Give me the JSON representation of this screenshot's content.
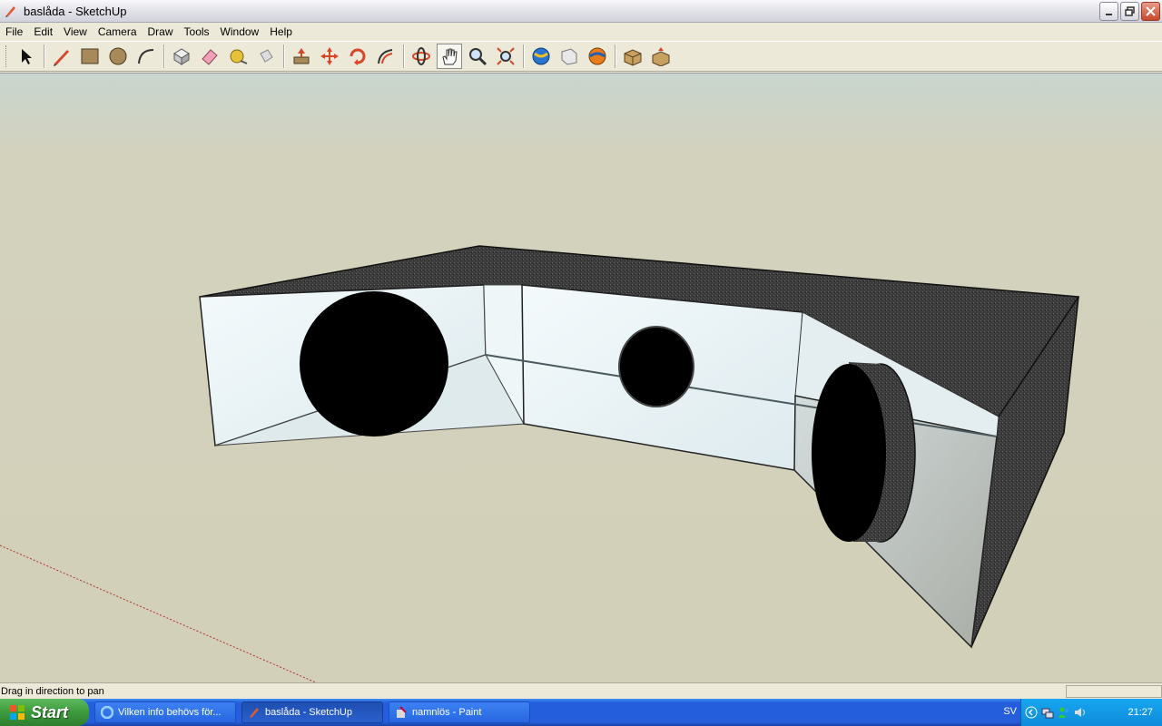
{
  "window": {
    "title": "baslåda - SketchUp",
    "controls": [
      "minimize",
      "restore",
      "close"
    ]
  },
  "menu": {
    "items": [
      "File",
      "Edit",
      "View",
      "Camera",
      "Draw",
      "Tools",
      "Window",
      "Help"
    ]
  },
  "toolbar": {
    "tools": [
      {
        "name": "select-tool",
        "icon": "arrow-icon"
      },
      {
        "name": "pencil-tool",
        "icon": "pencil-icon"
      },
      {
        "name": "rectangle-tool",
        "icon": "rectangle-icon"
      },
      {
        "name": "circle-tool",
        "icon": "circle-icon"
      },
      {
        "name": "arc-tool",
        "icon": "arc-icon"
      },
      {
        "name": "make-component-tool",
        "icon": "component-icon"
      },
      {
        "name": "eraser-tool",
        "icon": "eraser-icon"
      },
      {
        "name": "tape-measure-tool",
        "icon": "tape-measure-icon"
      },
      {
        "name": "paint-bucket-tool",
        "icon": "paint-bucket-icon"
      },
      {
        "name": "push-pull-tool",
        "icon": "push-pull-icon"
      },
      {
        "name": "move-tool",
        "icon": "move-icon"
      },
      {
        "name": "rotate-tool",
        "icon": "rotate-icon"
      },
      {
        "name": "offset-tool",
        "icon": "offset-icon"
      },
      {
        "name": "orbit-tool",
        "icon": "orbit-icon"
      },
      {
        "name": "pan-tool",
        "icon": "hand-icon",
        "active": true
      },
      {
        "name": "zoom-tool",
        "icon": "magnifier-icon"
      },
      {
        "name": "zoom-extents-tool",
        "icon": "zoom-extents-icon"
      },
      {
        "name": "get-models-tool",
        "icon": "globe-icon"
      },
      {
        "name": "share-model-tool",
        "icon": "share-icon"
      },
      {
        "name": "google-earth-tool",
        "icon": "earth-icon"
      },
      {
        "name": "get-components-tool",
        "icon": "components-box-icon"
      },
      {
        "name": "share-component-tool",
        "icon": "share-components-icon"
      }
    ]
  },
  "status": {
    "text": "Drag in direction to pan",
    "measurements_value": ""
  },
  "taskbar": {
    "start_label": "Start",
    "tasks": [
      {
        "label": "Vilken info behövs för...",
        "icon": "ie-icon",
        "active": false
      },
      {
        "label": "baslåda - SketchUp",
        "icon": "sketchup-icon",
        "active": true
      },
      {
        "label": "namnlös - Paint",
        "icon": "paint-icon",
        "active": false
      }
    ],
    "language": "SV",
    "clock": "21:27"
  },
  "colors": {
    "sky": "#C9D5CE",
    "ground": "#D3D0B9",
    "box_face_light": "#E9F3F6",
    "box_face_dark": "#3E3E3E",
    "port_hole": "#000000",
    "taskbar_blue": "#245EDC",
    "start_green": "#3C9A3C"
  }
}
